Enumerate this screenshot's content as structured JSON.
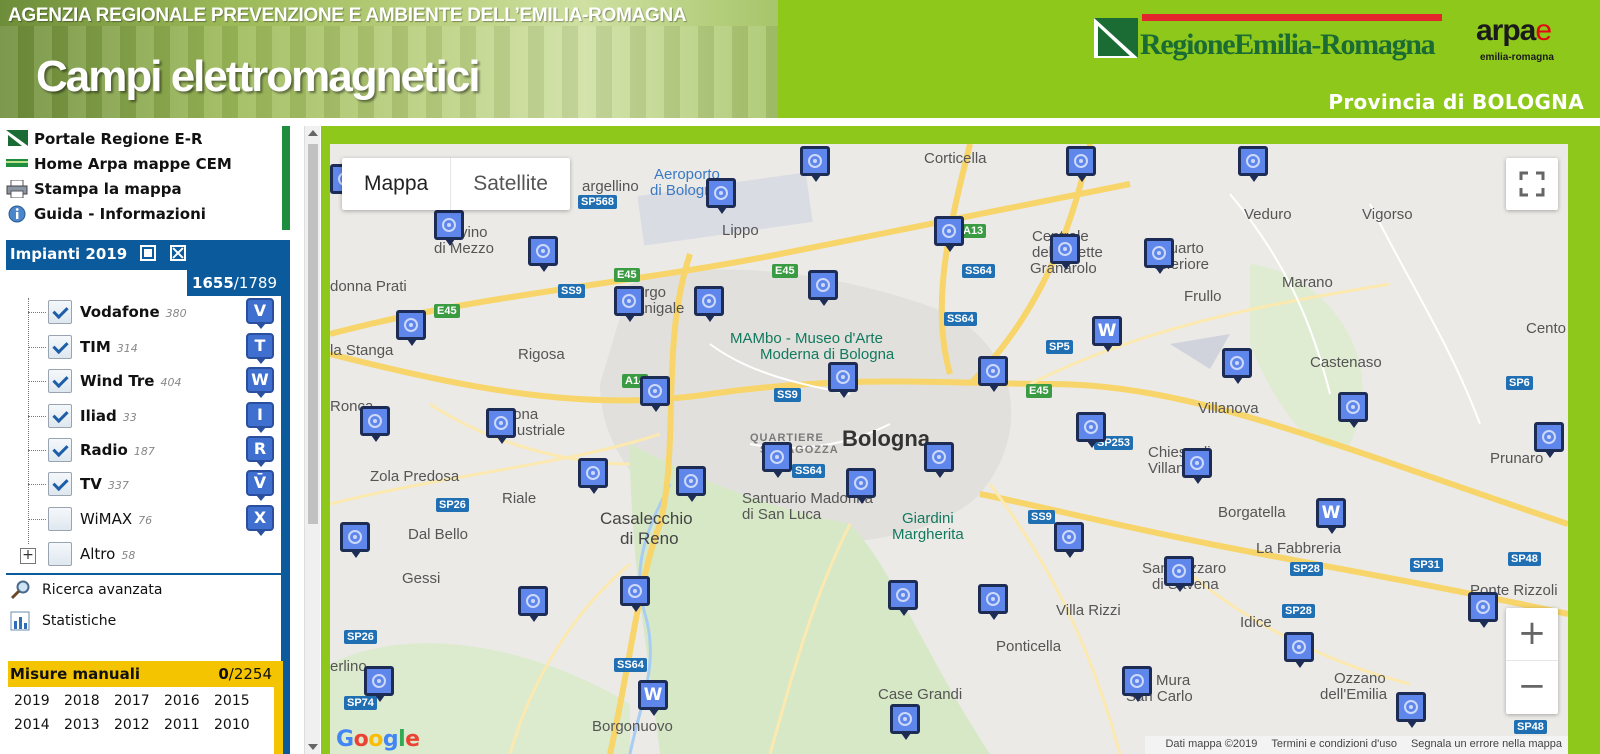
{
  "header": {
    "agency": "AGENZIA REGIONALE PREVENZIONE E AMBIENTE DELL’EMILIA-ROMAGNA",
    "app_title": "Campi elettromagnetici",
    "region_logo_text": "RegioneEmilia-Romagna",
    "arpae_logo_main_a": "arpa",
    "arpae_logo_main_b": "e",
    "arpae_logo_sub": "emilia-romagna",
    "province": "Provincia di BOLOGNA",
    "colors": {
      "header_green": "#8ec81a",
      "region_green": "#1a6b34",
      "red": "#e3262b"
    }
  },
  "links": [
    {
      "label": "Portale Regione E-R",
      "icon": "region-flag-icon"
    },
    {
      "label": "Home Arpa mappe CEM",
      "icon": "arpa-home-icon"
    },
    {
      "label": "Stampa la mappa",
      "icon": "printer-icon"
    },
    {
      "label": "Guida - Informazioni",
      "icon": "info-icon"
    }
  ],
  "impianti": {
    "title": "Impianti 2019",
    "count_shown": "1655",
    "count_total": "/1789",
    "operators": [
      {
        "name": "Vodafone",
        "count": "380",
        "checked": true,
        "badge": "V"
      },
      {
        "name": "TIM",
        "count": "314",
        "checked": true,
        "badge": "T"
      },
      {
        "name": "Wind Tre",
        "count": "404",
        "checked": true,
        "badge": "W"
      },
      {
        "name": "Iliad",
        "count": "33",
        "checked": true,
        "badge": "I"
      },
      {
        "name": "Radio",
        "count": "187",
        "checked": true,
        "badge": "R"
      },
      {
        "name": "TV",
        "count": "337",
        "checked": true,
        "badge": "V̄"
      },
      {
        "name": "WiMAX",
        "count": "76",
        "checked": false,
        "badge": "X"
      },
      {
        "name": "Altro",
        "count": "58",
        "checked": false,
        "badge": ""
      }
    ],
    "expander": "+",
    "color": "#0a5a9c"
  },
  "tools": [
    {
      "label": "Ricerca avanzata",
      "icon": "magnifier-icon"
    },
    {
      "label": "Statistiche",
      "icon": "statistics-icon"
    }
  ],
  "misure": {
    "title": "Misure manuali",
    "count_shown": "0",
    "count_total": "/2254",
    "years": [
      "2019",
      "2018",
      "2017",
      "2016",
      "2015",
      "2014",
      "2013",
      "2012",
      "2011",
      "2010"
    ],
    "color": "#f5c400"
  },
  "map": {
    "type_map": "Mappa",
    "type_satellite": "Satellite",
    "zoom_in": "+",
    "zoom_out": "−",
    "logo": "Google",
    "attribution": [
      "Dati mappa ©2019",
      "Termini e condizioni d'uso",
      "Segnala un errore nella mappa"
    ],
    "places": [
      {
        "t": "Corticella"
      },
      {
        "t": "Castenaso"
      },
      {
        "t": "Aeroporto"
      },
      {
        "t": "di Bologna"
      },
      {
        "t": "argellino"
      },
      {
        "t": "Lippo"
      },
      {
        "t": "vino"
      },
      {
        "t": "di Mezzo"
      },
      {
        "t": "Centrale"
      },
      {
        "t": "delle Sette"
      },
      {
        "t": "Granarolo"
      },
      {
        "t": "Quarto"
      },
      {
        "t": "Inferiore"
      },
      {
        "t": "Veduro"
      },
      {
        "t": "Vigorso"
      },
      {
        "t": "Marano"
      },
      {
        "t": "Frullo"
      },
      {
        "t": "donna Prati"
      },
      {
        "t": "Borgo"
      },
      {
        "t": "Panigale"
      },
      {
        "t": "MAMbo - Museo d'Arte"
      },
      {
        "t": "Moderna di Bologna"
      },
      {
        "t": "la Stanga"
      },
      {
        "t": "Rigosa"
      },
      {
        "t": "Ronca"
      },
      {
        "t": "Zona"
      },
      {
        "t": "Industriale"
      },
      {
        "t": "QUARTIERE"
      },
      {
        "t": "SARAGOZZA"
      },
      {
        "t": "Bologna"
      },
      {
        "t": "Villanova"
      },
      {
        "t": "Chiesa di"
      },
      {
        "t": "Villanova"
      },
      {
        "t": "Prunaro"
      },
      {
        "t": "Zola Predosa"
      },
      {
        "t": "Riale"
      },
      {
        "t": "Santuario Madonna"
      },
      {
        "t": "di San Luca"
      },
      {
        "t": "Giardini"
      },
      {
        "t": "Margherita"
      },
      {
        "t": "Borgatella"
      },
      {
        "t": "Dal Bello"
      },
      {
        "t": "Casalecchio"
      },
      {
        "t": "di Reno"
      },
      {
        "t": "La Fabbreria"
      },
      {
        "t": "Gessi"
      },
      {
        "t": "San Lazzaro"
      },
      {
        "t": "di Savena"
      },
      {
        "t": "Ponte Rizzoli"
      },
      {
        "t": "Villa Rizzi"
      },
      {
        "t": "Idice"
      },
      {
        "t": "Ponticella"
      },
      {
        "t": "erlino"
      },
      {
        "t": "Case Grandi"
      },
      {
        "t": "Mura"
      },
      {
        "t": "San Carlo"
      },
      {
        "t": "Ozzano"
      },
      {
        "t": "dell'Emilia"
      },
      {
        "t": "Borgonuovo"
      },
      {
        "t": "Cento"
      },
      {
        "t": "Castenaso"
      }
    ],
    "roads": [
      "SP568",
      "E45",
      "A13",
      "SS9",
      "E45",
      "SS64",
      "SS64",
      "E45",
      "SP5",
      "A14",
      "SS9",
      "SP253",
      "SS64",
      "E45",
      "SP6",
      "SP26",
      "SS9",
      "SP28",
      "SP31",
      "SP48",
      "SP26",
      "SP28",
      "SS64",
      "SP74",
      "SP48",
      "SP48"
    ]
  }
}
